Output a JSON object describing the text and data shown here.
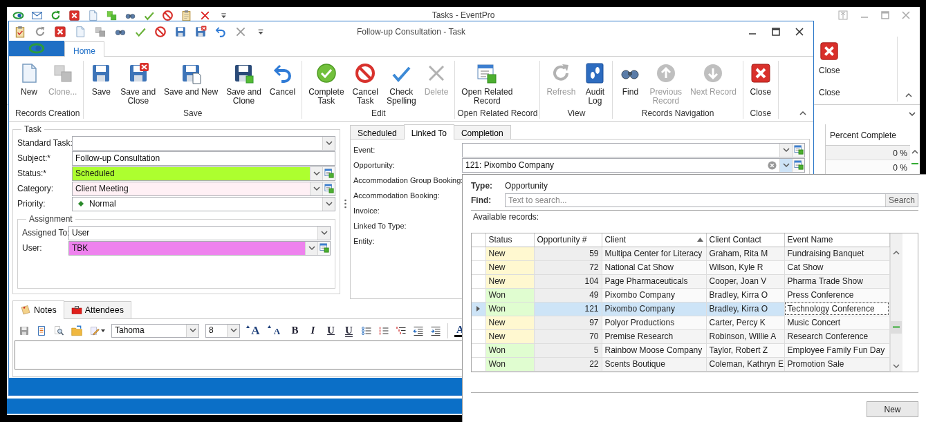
{
  "back_window": {
    "title": "Tasks - EventPro",
    "ribbon_button": {
      "label": "Close",
      "kind": "close"
    },
    "ribbon_group": "Close",
    "grid": {
      "column": "Percent Complete",
      "rows": [
        "0 %",
        "0 %"
      ]
    }
  },
  "window": {
    "title": "Follow-up Consultation - Task",
    "ribbon_tabs": [
      {
        "label": "Home",
        "selected": true
      }
    ],
    "ribbon_groups": [
      {
        "label": "Records Creation",
        "buttons": [
          {
            "label": "New",
            "kind": "new",
            "disabled": false
          },
          {
            "label": "Clone...",
            "kind": "clone",
            "disabled": true
          }
        ]
      },
      {
        "label": "Save",
        "buttons": [
          {
            "label": "Save",
            "kind": "save",
            "disabled": false
          },
          {
            "label": "Save and\nClose",
            "kind": "save-close",
            "disabled": false
          },
          {
            "label": "Save and New",
            "kind": "save-new",
            "disabled": false
          },
          {
            "label": "Save and\nClone",
            "kind": "save-clone",
            "disabled": false
          },
          {
            "label": "Cancel",
            "kind": "cancel",
            "disabled": false
          }
        ]
      },
      {
        "label": "Edit",
        "buttons": [
          {
            "label": "Complete\nTask",
            "kind": "complete",
            "disabled": false
          },
          {
            "label": "Cancel\nTask",
            "kind": "cancel-task",
            "disabled": false
          },
          {
            "label": "Check\nSpelling",
            "kind": "spelling",
            "disabled": false
          },
          {
            "label": "Delete",
            "kind": "delete",
            "disabled": true
          }
        ]
      },
      {
        "label": "Open Related Record",
        "buttons": [
          {
            "label": "Open Related\nRecord",
            "kind": "open-related",
            "disabled": false
          }
        ]
      },
      {
        "label": "View",
        "buttons": [
          {
            "label": "Refresh",
            "kind": "refresh",
            "disabled": true
          },
          {
            "label": "Audit\nLog",
            "kind": "audit",
            "disabled": false
          }
        ]
      },
      {
        "label": "Records Navigation",
        "buttons": [
          {
            "label": "Find",
            "kind": "find",
            "disabled": false
          },
          {
            "label": "Previous\nRecord",
            "kind": "previous",
            "disabled": true
          },
          {
            "label": "Next Record",
            "kind": "next",
            "disabled": true
          }
        ]
      },
      {
        "label": "Close",
        "buttons": [
          {
            "label": "Close",
            "kind": "close",
            "disabled": false
          }
        ]
      }
    ]
  },
  "task": {
    "title": "Task",
    "fields": [
      {
        "label": "Standard Task:",
        "kind": "combo"
      },
      {
        "label": "Subject:*",
        "kind": "text",
        "value": "Follow-up Consultation"
      },
      {
        "label": "Status:*",
        "kind": "combo-edit",
        "value": "Scheduled",
        "color": "#adff2f"
      },
      {
        "label": "Category:",
        "kind": "combo-edit",
        "value": "Client Meeting",
        "color": "#fff0f5"
      },
      {
        "label": "Priority:",
        "kind": "priority",
        "value": "Normal"
      }
    ],
    "assignment": {
      "title": "Assignment",
      "fields": [
        {
          "label": "Assigned To:",
          "kind": "combo",
          "value": "User"
        },
        {
          "label": "User:",
          "kind": "combo-edit",
          "value": "TBK",
          "color": "#ee82ee"
        }
      ]
    }
  },
  "linked": {
    "tabs": [
      {
        "label": "Scheduled",
        "selected": false
      },
      {
        "label": "Linked To",
        "selected": true
      },
      {
        "label": "Completion",
        "selected": false
      }
    ],
    "fields": [
      {
        "label": "Event:",
        "kind": "combo-edit"
      },
      {
        "label": "Opportunity:",
        "kind": "combo-clear",
        "value": "121: Pixombo Company"
      },
      {
        "label": "Accommodation Group Booking:",
        "kind": "label"
      },
      {
        "label": "Accommodation Booking:",
        "kind": "label"
      },
      {
        "label": "Invoice:",
        "kind": "label"
      },
      {
        "label": "Linked To Type:",
        "kind": "label"
      },
      {
        "label": "Entity:",
        "kind": "label"
      }
    ]
  },
  "notes": {
    "tabs": [
      {
        "label": "Notes",
        "kind": "notes",
        "selected": true
      },
      {
        "label": "Attendees",
        "kind": "attendees",
        "selected": false
      }
    ],
    "font": "Tahoma",
    "font_size": "8",
    "format_buttons": [
      {
        "kind": "grow",
        "label": "A"
      },
      {
        "kind": "shrink",
        "label": "A"
      },
      {
        "kind": "bold",
        "label": "B"
      },
      {
        "kind": "italic",
        "label": "I"
      },
      {
        "kind": "underline",
        "label": "U"
      },
      {
        "kind": "double-underline",
        "label": "U"
      },
      {
        "kind": "font-color",
        "label": "A"
      }
    ]
  },
  "lookup": {
    "type_label": "Type:",
    "type_value": "Opportunity",
    "find_label": "Find:",
    "find_placeholder": "Text to search...",
    "search_button": "Search",
    "records_label": "Available records:",
    "columns": [
      {
        "label": "Status",
        "sort_ascending": false
      },
      {
        "label": "Opportunity #",
        "sort_ascending": false
      },
      {
        "label": "Client",
        "sort_ascending": true
      },
      {
        "label": "Client Contact",
        "sort_ascending": false
      },
      {
        "label": "Event Name",
        "sort_ascending": false
      }
    ],
    "rows": [
      {
        "status": "New",
        "number": "59",
        "client": "Multipa Center for Literacy",
        "contact": "Graham, Rita M",
        "event": "Fundraising Banquet",
        "color": "#fff8d0",
        "selected": false
      },
      {
        "status": "New",
        "number": "72",
        "client": "National Cat Show",
        "contact": "Wilson, Kyle R",
        "event": "Cat Show",
        "color": "#fff8d0",
        "selected": false
      },
      {
        "status": "New",
        "number": "104",
        "client": "Page Pharmaceuticals",
        "contact": "Cooper, Joan V",
        "event": "Pharma Trade Show",
        "color": "#fff8d0",
        "selected": false
      },
      {
        "status": "Won",
        "number": "49",
        "client": "Pixombo Company",
        "contact": "Bradley, Kirra O",
        "event": "Press Conference",
        "color": "#e0fdd0",
        "selected": false
      },
      {
        "status": "Won",
        "number": "121",
        "client": "Pixombo Company",
        "contact": "Bradley, Kirra O",
        "event": "Technology Conference",
        "color": "#e0fdd0",
        "selected": true
      },
      {
        "status": "New",
        "number": "97",
        "client": "Polyor Productions",
        "contact": "Carter, Percy K",
        "event": "Music Concert",
        "color": "#fff8d0",
        "selected": false
      },
      {
        "status": "New",
        "number": "70",
        "client": "Premise Research",
        "contact": "Robinson, Willie A",
        "event": "Research Conference",
        "color": "#fff8d0",
        "selected": false
      },
      {
        "status": "Won",
        "number": "5",
        "client": "Rainbow Moose Company",
        "contact": "Taylor, Robert Z",
        "event": "Employee Family Fun Day",
        "color": "#e0fdd0",
        "selected": false
      },
      {
        "status": "Won",
        "number": "22",
        "client": "Scents Boutique",
        "contact": "Coleman, Kathryn E",
        "event": "Promotion Sale",
        "color": "#e0fdd0",
        "selected": false
      }
    ],
    "new_button": "New"
  }
}
